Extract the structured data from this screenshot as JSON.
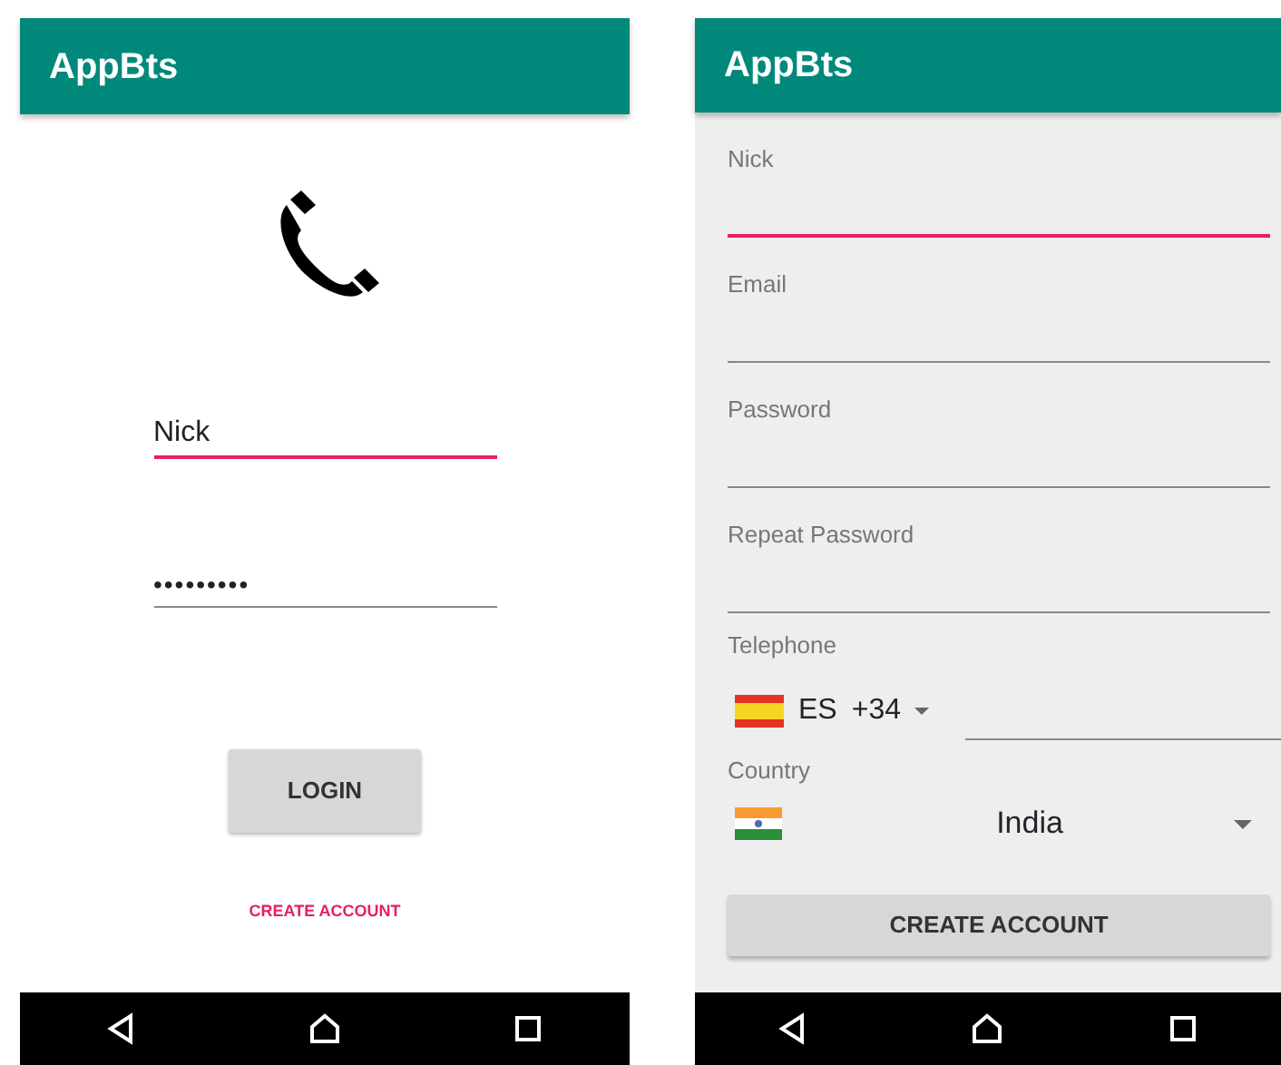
{
  "screens": [
    {
      "kind": "login",
      "app_bar": {
        "title": "AppBts"
      },
      "fields": [
        {
          "kind": "text",
          "value": "Nick",
          "focused": true
        },
        {
          "kind": "password",
          "value": "•••••••••",
          "focused": false
        }
      ],
      "button": "LOGIN",
      "link": "CREATE ACCOUNT"
    },
    {
      "kind": "register",
      "app_bar": {
        "title": "AppBts"
      },
      "fields": [
        {
          "label": "Nick",
          "focused": true
        },
        {
          "label": "Email",
          "focused": false
        },
        {
          "label": "Password",
          "focused": false
        },
        {
          "label": "Repeat Password",
          "focused": false
        }
      ],
      "telephone": {
        "label": "Telephone",
        "country_code": "ES",
        "dial_code": "+34"
      },
      "country": {
        "label": "Country",
        "value": "India"
      },
      "button": "CREATE ACCOUNT"
    }
  ]
}
